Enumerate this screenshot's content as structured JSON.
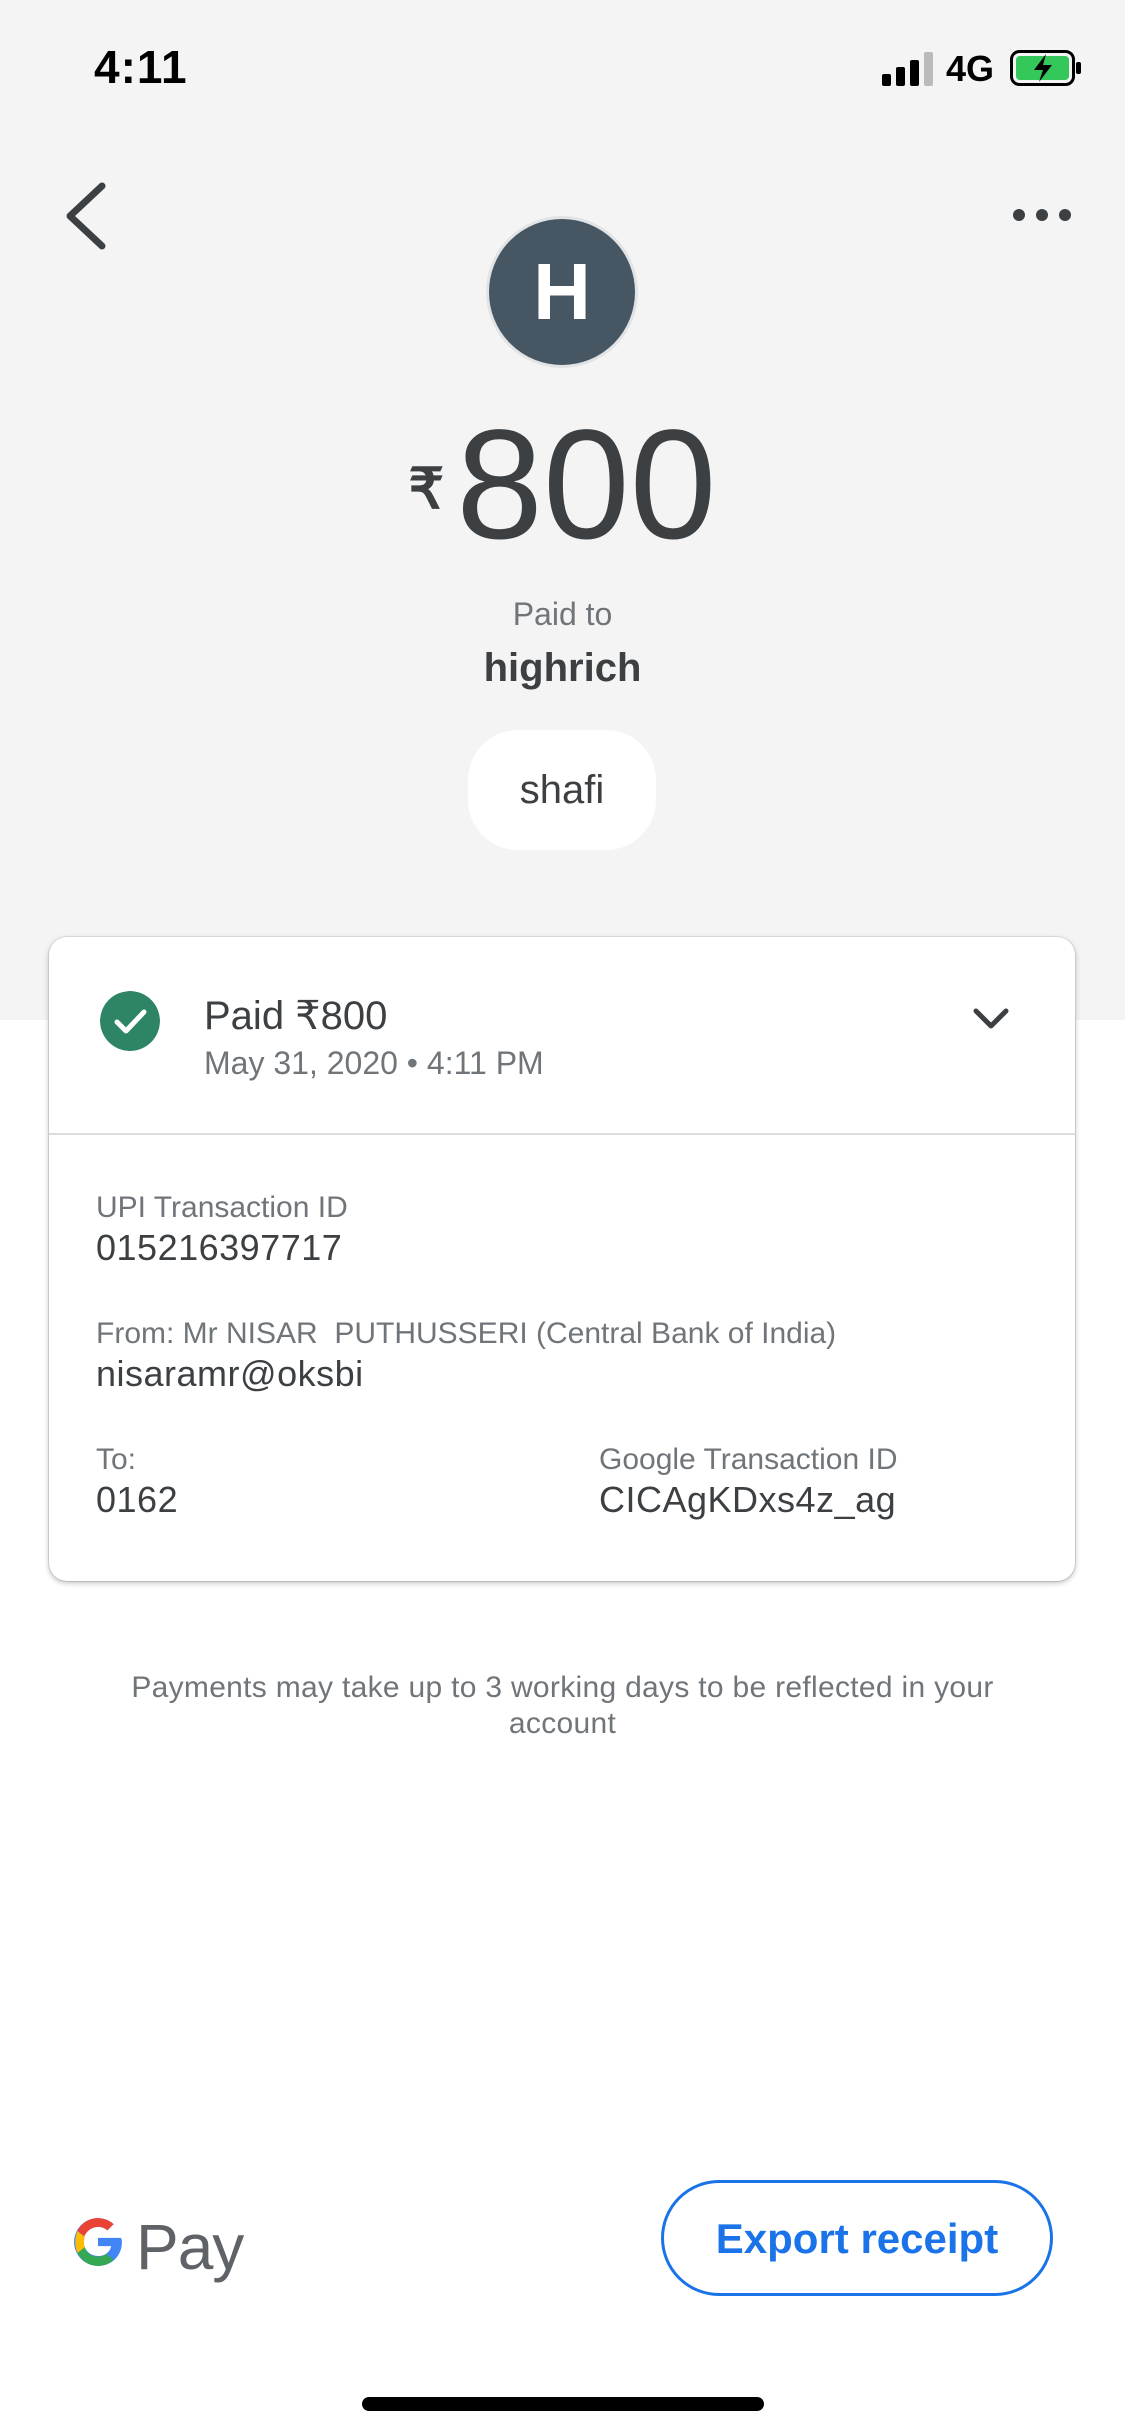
{
  "status_bar": {
    "time": "4:11",
    "network": "4G",
    "icons": [
      "signal-icon",
      "battery-charging-icon"
    ]
  },
  "nav": {
    "back_icon": "chevron-left-icon",
    "more_icon": "more-horizontal-icon"
  },
  "payee": {
    "avatar_initial": "H",
    "avatar_color": "#475663",
    "currency_symbol": "₹",
    "amount": "800",
    "paid_to_label": "Paid to",
    "name": "highrich",
    "note": "shafi"
  },
  "transaction_card": {
    "status_icon": "check-circle-icon",
    "status_color": "#2e8566",
    "summary": "Paid ₹800",
    "date_time": "May 31, 2020 • 4:11 PM",
    "expand_icon": "chevron-down-icon",
    "upi_id_label": "UPI Transaction ID",
    "upi_id": "015216397717",
    "from_label": "From: Mr NISAR  PUTHUSSERI (Central Bank of India)",
    "from_value": "nisaramr@oksbi",
    "to_label": "To:",
    "to_value": "0162",
    "google_id_label": "Google Transaction ID",
    "google_id": "CICAgKDxs4z_ag"
  },
  "disclaimer": "Payments may take up to 3 working days to be reflected in your account",
  "footer": {
    "brand": "Pay",
    "brand_icon": "google-g-logo",
    "export_label": "Export receipt",
    "accent_color": "#1a73e8"
  }
}
